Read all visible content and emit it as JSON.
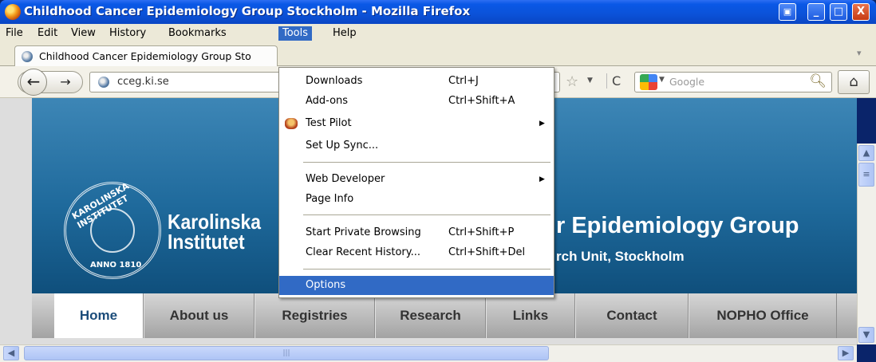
{
  "window": {
    "title": "Childhood Cancer Epidemiology Group Stockholm - Mozilla Firefox",
    "controls": {
      "minimize": "_",
      "maximize": "□",
      "close": "X"
    }
  },
  "menubar": {
    "items": [
      "File",
      "Edit",
      "View",
      "History",
      "Bookmarks",
      "Tools",
      "Help"
    ],
    "active": "Tools"
  },
  "tabs": [
    {
      "label": "Childhood Cancer Epidemiology Group Sto",
      "active": true
    }
  ],
  "navbar": {
    "url": "cceg.ki.se",
    "search_placeholder": "Google",
    "icons": [
      "back-icon",
      "forward-icon",
      "site-identity-icon",
      "bookmark-star-icon",
      "reload-icon",
      "google-icon",
      "search-icon",
      "home-icon"
    ]
  },
  "tools_menu": {
    "items": [
      {
        "label": "Downloads",
        "shortcut": "Ctrl+J"
      },
      {
        "label": "Add-ons",
        "shortcut": "Ctrl+Shift+A"
      },
      {
        "label": "Test Pilot",
        "submenu": true,
        "icon": "test-pilot-icon"
      },
      {
        "label": "Set Up Sync..."
      },
      {
        "label": "Web Developer",
        "submenu": true
      },
      {
        "label": "Page Info"
      },
      {
        "label": "Start Private Browsing",
        "shortcut": "Ctrl+Shift+P"
      },
      {
        "label": "Clear Recent History...",
        "shortcut": "Ctrl+Shift+Del"
      },
      {
        "label": "Options",
        "highlighted": true
      }
    ]
  },
  "page": {
    "institute_line1": "Karolinska",
    "institute_line2": "Institutet",
    "seal_top": "KAROLINSKA INSTITUTET",
    "seal_bottom": "ANNO 1810",
    "title": "r Epidemiology Group",
    "subtitle": "rch Unit, Stockholm",
    "nav": [
      "Home",
      "About us",
      "Registries",
      "Research",
      "Links",
      "Contact",
      "NOPHO Office"
    ],
    "nav_active": "Home"
  },
  "colors": {
    "titlebar": "#0b52d8",
    "menu_highlight": "#316ac5",
    "banner": "#1f6a9c",
    "nav_active_text": "#1b4c7a"
  }
}
